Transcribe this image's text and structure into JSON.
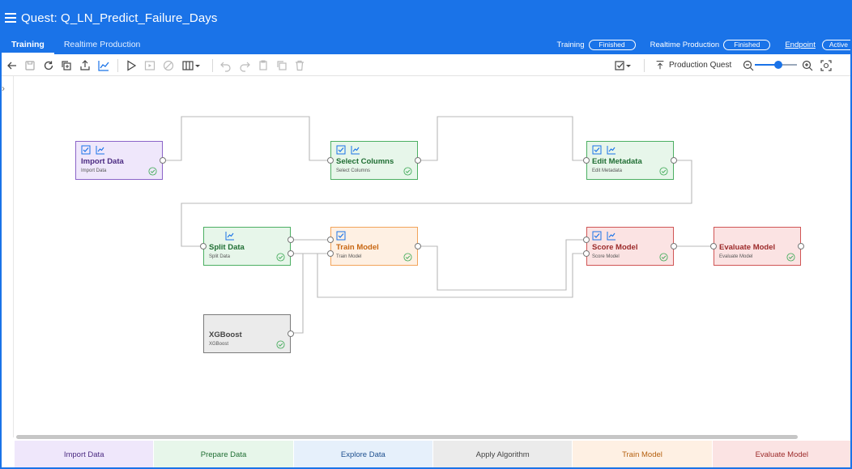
{
  "app": {
    "title": "Quest: Q_LN_Predict_Failure_Days"
  },
  "tabs": [
    {
      "label": "Training",
      "active": true
    },
    {
      "label": "Realtime Production",
      "active": false
    }
  ],
  "status": {
    "training_label": "Training",
    "training_value": "Finished",
    "realtime_label": "Realtime Production",
    "realtime_value": "Finished",
    "endpoint_label": "Endpoint",
    "endpoint_value": "Active"
  },
  "toolbar": {
    "production_quest_label": "Production Quest",
    "zoom_level": 0.55
  },
  "colors": {
    "header": "#1a73e8",
    "import_data": "#8b64c8",
    "prepare_data": "#4caf62",
    "train_model": "#f2a45a",
    "evaluate_model": "#d05555",
    "algorithm": "#7a7a7a"
  },
  "nodes": {
    "import_data": {
      "title": "Import Data",
      "sub": "Import Data"
    },
    "select_columns": {
      "title": "Select Columns",
      "sub": "Select Columns"
    },
    "edit_metadata": {
      "title": "Edit Metadata",
      "sub": "Edit Metadata"
    },
    "split_data": {
      "title": "Split Data",
      "sub": "Split Data"
    },
    "train_model": {
      "title": "Train Model",
      "sub": "Train Model"
    },
    "score_model": {
      "title": "Score Model",
      "sub": "Score Model"
    },
    "evaluate_model": {
      "title": "Evaluate Model",
      "sub": "Evaluate Model"
    },
    "xgboost": {
      "title": "XGBoost",
      "sub": "XGBoost"
    }
  },
  "palette": [
    "Import Data",
    "Prepare Data",
    "Explore Data",
    "Apply Algorithm",
    "Train Model",
    "Evaluate Model"
  ]
}
